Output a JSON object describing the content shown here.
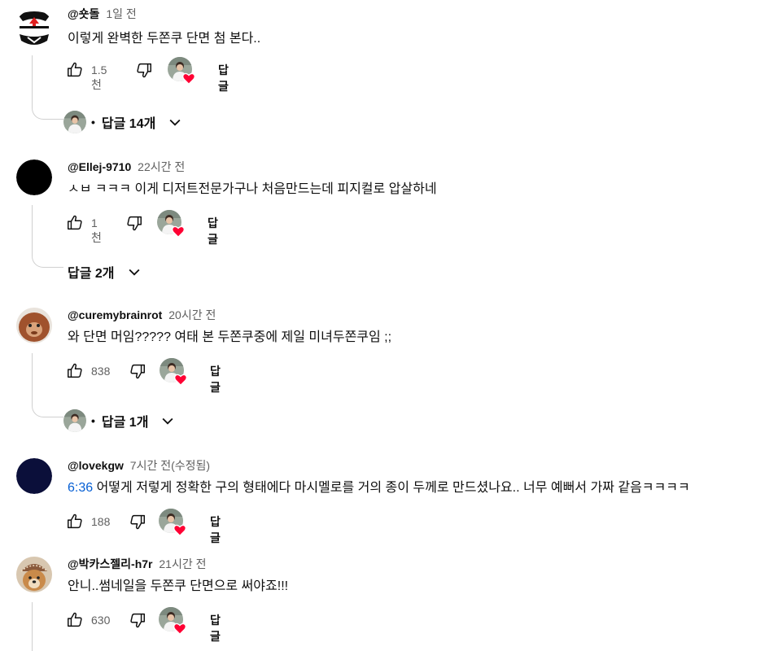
{
  "comments": [
    {
      "author": "@숏돌",
      "time": "1일 전",
      "timestamp_link": "",
      "text": "이렇게 완벽한 두쫀쿠 단면 첨 본다..",
      "likes": "1.5천",
      "reply_label": "답글",
      "replies": {
        "label": "답글 14개",
        "dot": "•"
      },
      "avatar_icon": "red-arrow-emblem-avatar"
    },
    {
      "author": "@Ellej-9710",
      "time": "22시간 전",
      "timestamp_link": "",
      "text": "ㅅㅂ ㅋㅋㅋ 이게 디저트전문가구나 처음만드는데 피지컬로 압살하네",
      "likes": "1천",
      "reply_label": "답글",
      "replies": {
        "label": "답글 2개",
        "dot": ""
      },
      "avatar_icon": "black-circle-avatar"
    },
    {
      "author": "@curemybrainrot",
      "time": "20시간 전",
      "timestamp_link": "",
      "text": "와 단면 머임????? 여태 본 두쫀쿠중에 제일 미녀두쫀쿠임 ;;",
      "likes": "838",
      "reply_label": "답글",
      "replies": {
        "label": "답글 1개",
        "dot": "•"
      },
      "avatar_icon": "orangutan-avatar"
    },
    {
      "author": "@lovekgw",
      "time": "7시간 전(수정됨)",
      "timestamp_link": "6:36",
      "text": " 어떻게 저렇게 정확한 구의 형태에다 마시멜로를 거의 종이 두께로 만드셨나요.. 너무 예뻐서 가짜 같음ㅋㅋㅋㅋ",
      "likes": "188",
      "reply_label": "답글",
      "replies": null,
      "avatar_icon": "navy-circle-avatar"
    },
    {
      "author": "@박카스젤리-h7r",
      "time": "21시간 전",
      "timestamp_link": "",
      "text": "안니..썸네일을 두쫀쿠 단면으로 써야죠!!!",
      "likes": "630",
      "reply_label": "답글",
      "replies": null,
      "avatar_icon": "dog-avatar"
    }
  ],
  "colors": {
    "link": "#065fd4",
    "heart": "#ff0033",
    "meta": "#606060",
    "thread_line": "#d0d0d0"
  },
  "icons": {
    "like": "thumbs-up-icon",
    "dislike": "thumbs-down-icon",
    "creator_heart": "creator-heart-icon",
    "expand": "chevron-down-icon"
  }
}
